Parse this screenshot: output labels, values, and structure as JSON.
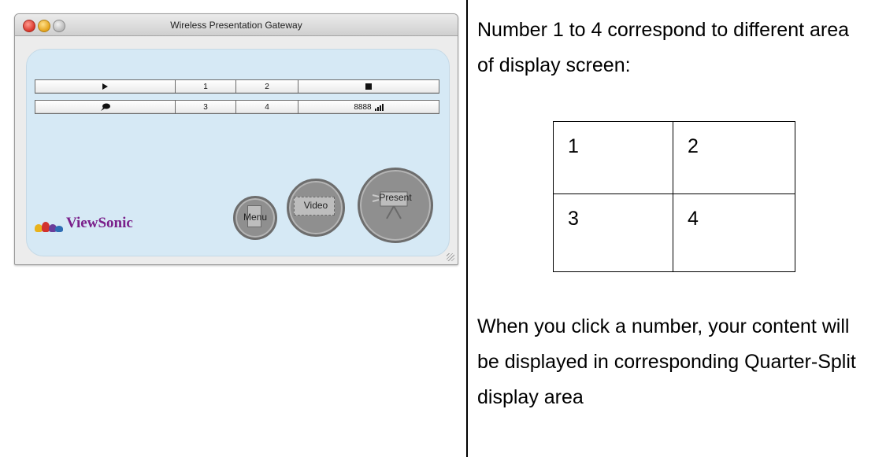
{
  "window": {
    "title": "Wireless Presentation Gateway",
    "row1": {
      "play": "play-icon",
      "q1": "1",
      "q2": "2",
      "stop": "stop-icon"
    },
    "row2": {
      "comment": "comment-icon",
      "q3": "3",
      "q4": "4",
      "code": "8888"
    },
    "buttons": {
      "menu": "Menu",
      "video": "Video",
      "present": "Present"
    },
    "logo": "ViewSonic"
  },
  "description": {
    "intro": "Number 1 to 4 correspond to different area of display screen:",
    "grid": [
      "1",
      "2",
      "3",
      "4"
    ],
    "note": "When you click a number, your content will be displayed in corresponding Quarter-Split display area"
  }
}
